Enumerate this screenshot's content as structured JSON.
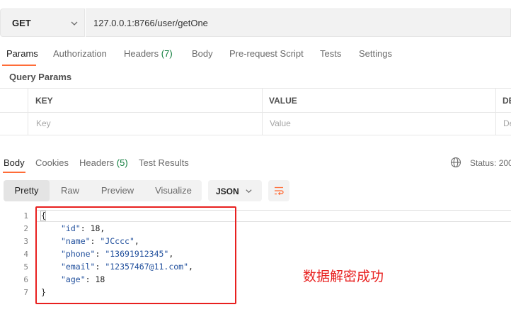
{
  "request": {
    "method": "GET",
    "url": "127.0.0.1:8766/user/getOne"
  },
  "request_tabs": [
    {
      "label": "Params",
      "count": ""
    },
    {
      "label": "Authorization",
      "count": ""
    },
    {
      "label": "Headers",
      "count": "(7)"
    },
    {
      "label": "Body",
      "count": ""
    },
    {
      "label": "Pre-request Script",
      "count": ""
    },
    {
      "label": "Tests",
      "count": ""
    },
    {
      "label": "Settings",
      "count": ""
    }
  ],
  "query_params": {
    "title": "Query Params",
    "headers": [
      "KEY",
      "VALUE",
      "DE"
    ],
    "placeholders": [
      "Key",
      "Value",
      "De"
    ]
  },
  "response_tabs": [
    {
      "label": "Body",
      "count": ""
    },
    {
      "label": "Cookies",
      "count": ""
    },
    {
      "label": "Headers",
      "count": "(5)"
    },
    {
      "label": "Test Results",
      "count": ""
    }
  ],
  "status_text": "Status: 200",
  "format_options": [
    "Pretty",
    "Raw",
    "Preview",
    "Visualize"
  ],
  "language": "JSON",
  "line_numbers": [
    "1",
    "2",
    "3",
    "4",
    "5",
    "6",
    "7"
  ],
  "json_body": {
    "open": "{",
    "fields": [
      {
        "key": "\"id\"",
        "value": "18",
        "type": "number",
        "comma": ","
      },
      {
        "key": "\"name\"",
        "value": "\"JCccc\"",
        "type": "string",
        "comma": ","
      },
      {
        "key": "\"phone\"",
        "value": "\"13691912345\"",
        "type": "string",
        "comma": ","
      },
      {
        "key": "\"email\"",
        "value": "\"12357467@11.com\"",
        "type": "string",
        "comma": ","
      },
      {
        "key": "\"age\"",
        "value": "18",
        "type": "number",
        "comma": ""
      }
    ],
    "close": "}"
  },
  "annotation": "数据解密成功",
  "colors": {
    "accent": "#ff6c37",
    "annotation_red": "#e8201f",
    "count_green": "#0c7b3a",
    "json_blue": "#1f4e9c"
  }
}
